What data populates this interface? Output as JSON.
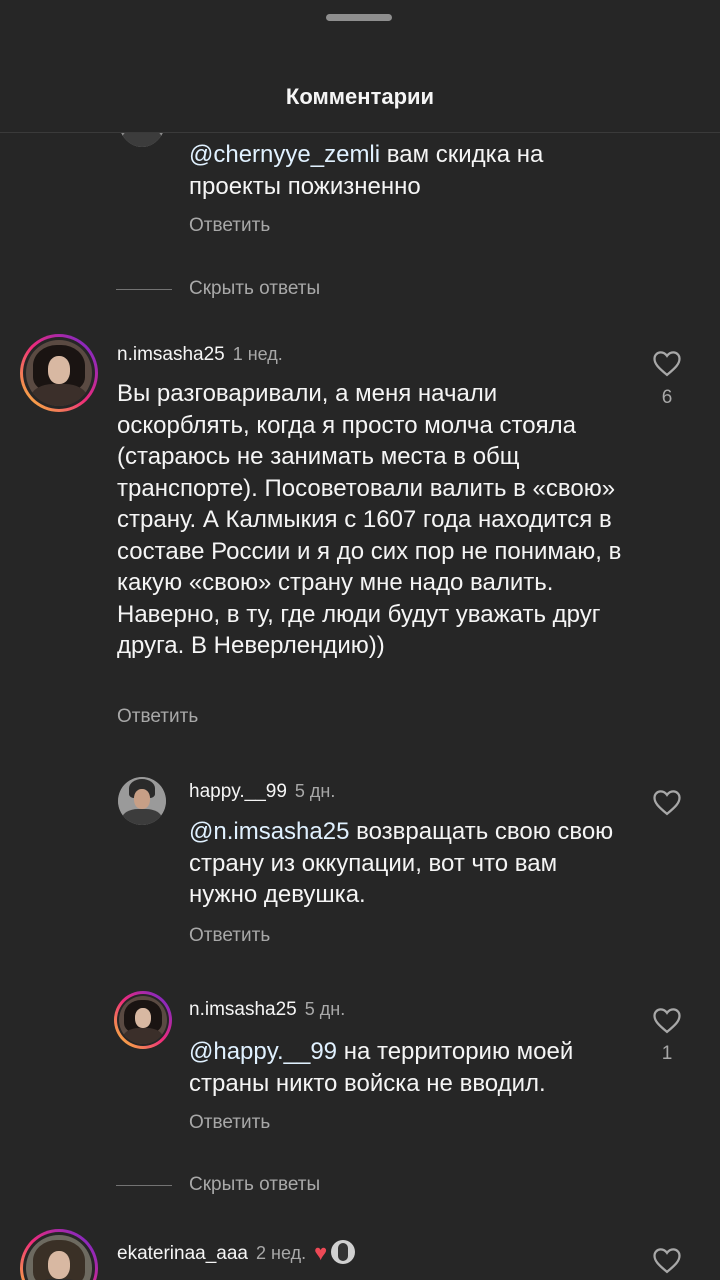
{
  "header": {
    "title": "Комментарии"
  },
  "colors": {
    "background": "#262626",
    "text": "#f5f5f5",
    "secondary": "#a8a8a8",
    "like_red": "#ed4956"
  },
  "comments": [
    {
      "text_mention": "@chernyye_zemli",
      "text_rest": " вам скидка на проекты пожизненно",
      "reply_label": "Ответить"
    },
    {
      "hide_replies_label": "Скрыть ответы"
    },
    {
      "username": "n.imsasha25",
      "time": "1 нед.",
      "text": "Вы разговаривали, а меня начали оскорблять, когда я просто молча стояла (стараюсь не занимать места в общ транспорте). Посоветовали валить в «свою» страну. А Калмыкия с 1607 года находится в составе России и я до сих пор не понимаю, в какую «свою» страну мне надо валить. Наверно, в ту, где люди будут уважать друг друга. В Неверлендию))",
      "reply_label": "Ответить",
      "likes": "6"
    },
    {
      "username": "happy.__99",
      "time": "5 дн.",
      "text_mention": "@n.imsasha25",
      "text_rest": " возвращать свою свою страну из оккупации, вот что вам нужно девушка.",
      "reply_label": "Ответить"
    },
    {
      "username": "n.imsasha25",
      "time": "5 дн.",
      "text_mention": "@happy.__99",
      "text_rest": " на территорию моей страны никто войска не вводил.",
      "reply_label": "Ответить",
      "likes": "1"
    },
    {
      "hide_replies_label": "Скрыть ответы"
    },
    {
      "username": "ekaterinaa_aaa",
      "time": "2 нед."
    }
  ]
}
